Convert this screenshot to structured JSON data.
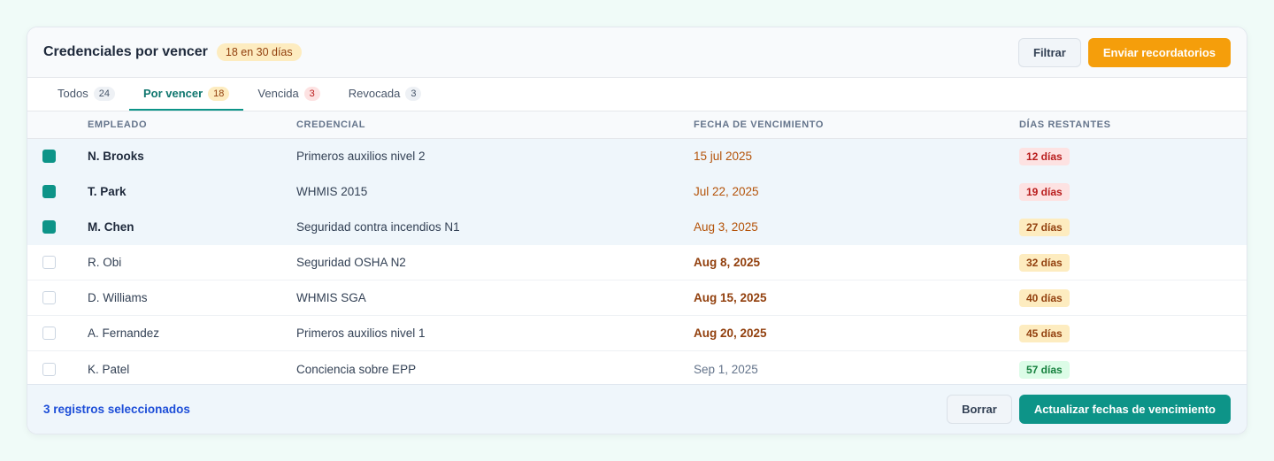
{
  "header": {
    "title": "Credenciales por vencer",
    "badge": "18 en 30 días",
    "filter_label": "Filtrar",
    "send_label": "Enviar recordatorios"
  },
  "tabs": [
    {
      "label": "Todos",
      "count": "24"
    },
    {
      "label": "Por vencer",
      "count": "18"
    },
    {
      "label": "Vencida",
      "count": "3"
    },
    {
      "label": "Revocada",
      "count": "3"
    }
  ],
  "columns": {
    "employee": "EMPLEADO",
    "credential": "CREDENCIAL",
    "expiry": "FECHA DE VENCIMIENTO",
    "days": "DÍAS RESTANTES"
  },
  "rows": [
    {
      "employee": "N. Brooks",
      "credential": "Primeros auxilios nivel 2",
      "date": "15 jul 2025",
      "days": "12 días",
      "selected": true
    },
    {
      "employee": "T. Park",
      "credential": "WHMIS 2015",
      "date": "Jul 22, 2025",
      "days": "19 días",
      "selected": true
    },
    {
      "employee": "M. Chen",
      "credential": "Seguridad contra incendios N1",
      "date": "Aug 3, 2025",
      "days": "27 días",
      "selected": true
    },
    {
      "employee": "R. Obi",
      "credential": "Seguridad OSHA N2",
      "date": "Aug 8, 2025",
      "days": "32 días",
      "selected": false
    },
    {
      "employee": "D. Williams",
      "credential": "WHMIS SGA",
      "date": "Aug 15, 2025",
      "days": "40 días",
      "selected": false
    },
    {
      "employee": "A. Fernandez",
      "credential": "Primeros auxilios nivel 1",
      "date": "Aug 20, 2025",
      "days": "45 días",
      "selected": false
    },
    {
      "employee": "K. Patel",
      "credential": "Conciencia sobre EPP",
      "date": "Sep 1, 2025",
      "days": "57 días",
      "selected": false
    }
  ],
  "footer": {
    "selected_text": "3 registros seleccionados",
    "clear_label": "Borrar",
    "update_label": "Actualizar fechas de vencimiento"
  },
  "colors": {
    "accent": "#0d9488",
    "warning": "#f59e0b",
    "danger": "#b91c1c",
    "success": "#15803d"
  }
}
